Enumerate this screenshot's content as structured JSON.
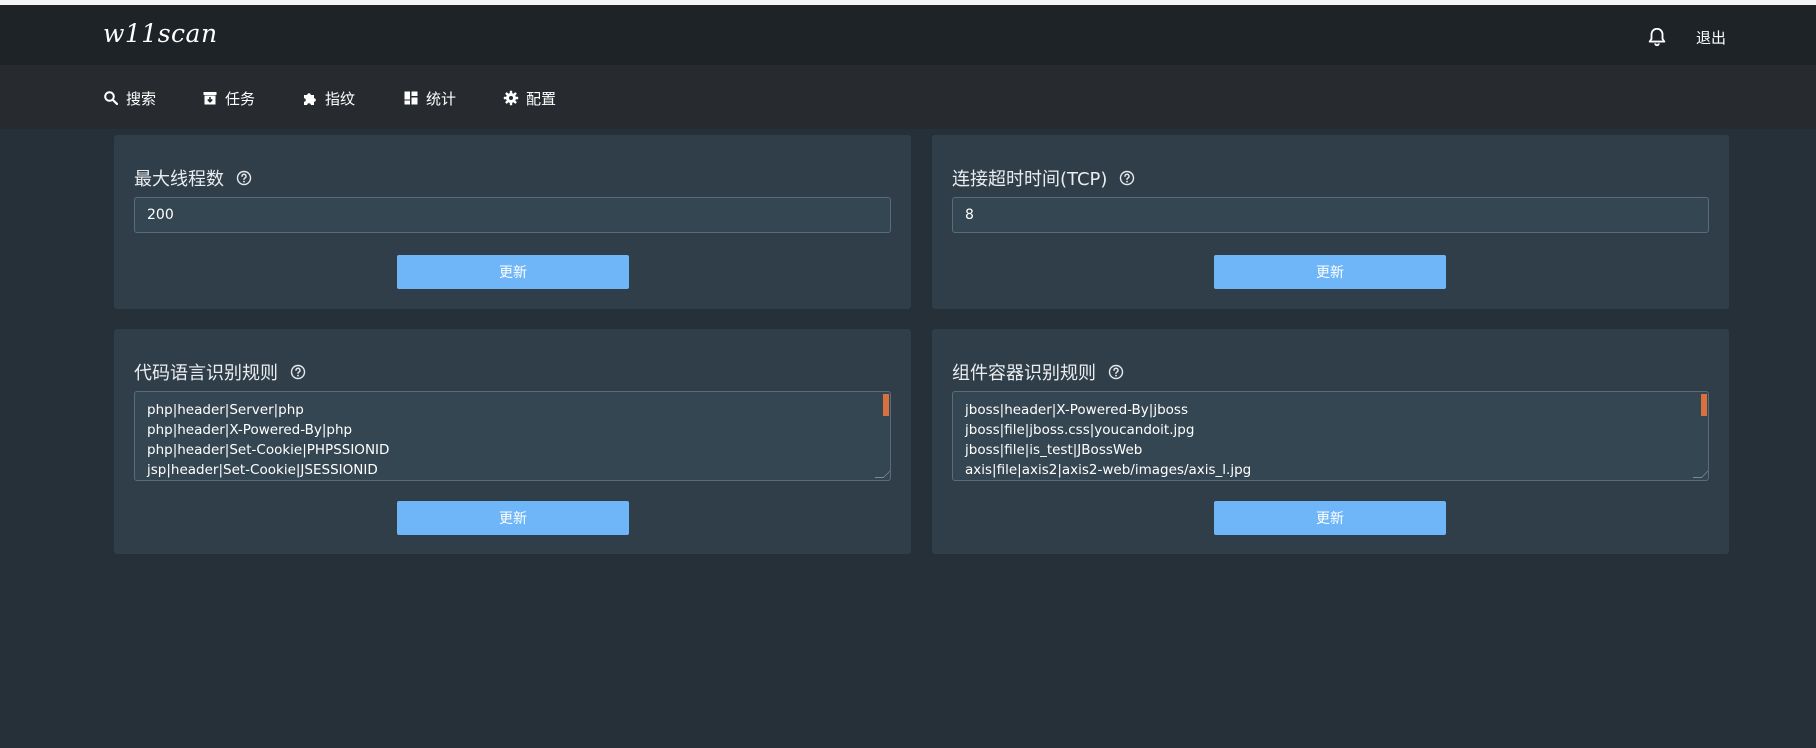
{
  "app": {
    "logo": "w11scan"
  },
  "header": {
    "logout_label": "退出",
    "bell_icon": "bell-icon"
  },
  "nav": {
    "items": [
      {
        "label": "搜索",
        "icon": "search-icon"
      },
      {
        "label": "任务",
        "icon": "archive-icon"
      },
      {
        "label": "指纹",
        "icon": "puzzle-icon"
      },
      {
        "label": "统计",
        "icon": "dashboard-icon"
      },
      {
        "label": "配置",
        "icon": "gear-icon"
      }
    ]
  },
  "cards": {
    "max_threads": {
      "title": "最大线程数",
      "value": "200",
      "button": "更新"
    },
    "tcp_timeout": {
      "title": "连接超时时间(TCP)",
      "value": "8",
      "button": "更新"
    },
    "code_lang_rules": {
      "title": "代码语言识别规则",
      "lines": [
        "php|header|Server|php",
        "php|header|X-Powered-By|php",
        "php|header|Set-Cookie|PHPSSIONID",
        "jsp|header|Set-Cookie|JSESSIONID"
      ],
      "button": "更新"
    },
    "component_rules": {
      "title": "组件容器识别规则",
      "lines": [
        "jboss|header|X-Powered-By|jboss",
        "jboss|file|jboss.css|youcandoit.jpg",
        "jboss|file|is_test|JBossWeb",
        "axis|file|axis2|axis2-web/images/axis_l.jpg"
      ],
      "button": "更新"
    }
  },
  "colors": {
    "accent_button": "#6fb6f8",
    "scrollbar": "#d9713f"
  }
}
